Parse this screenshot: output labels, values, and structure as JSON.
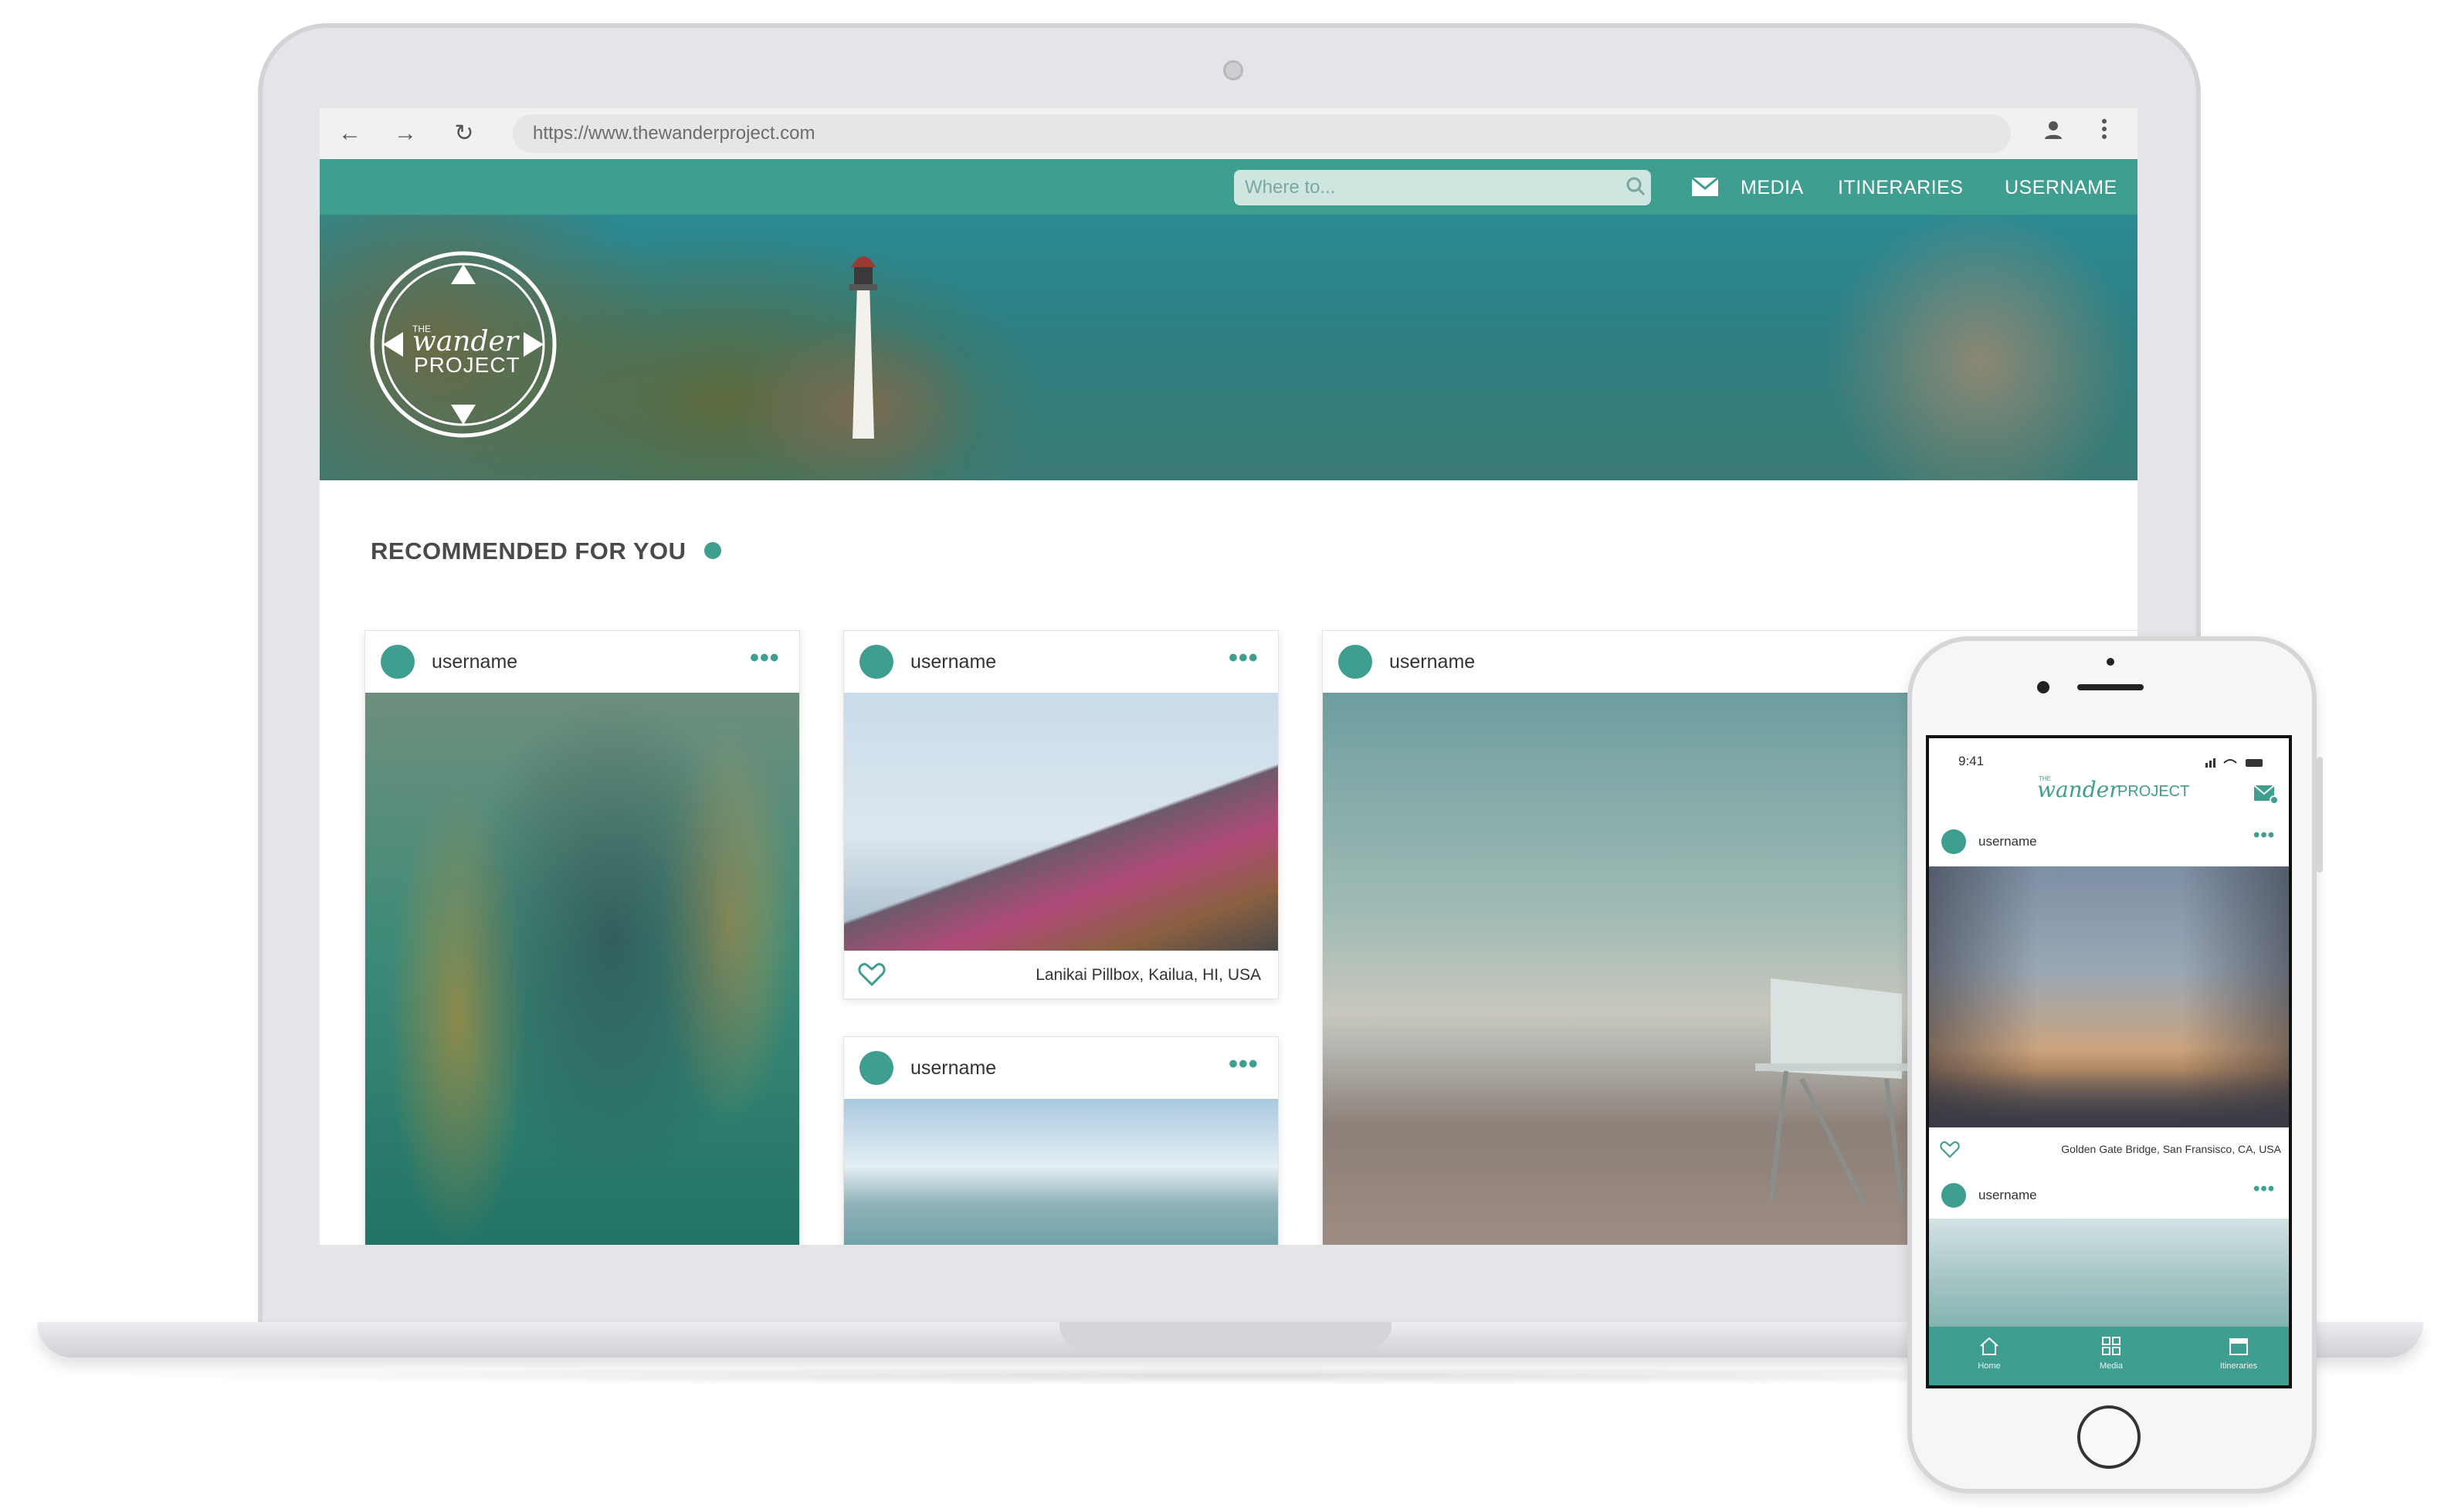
{
  "browser": {
    "url": "https://www.thewanderproject.com"
  },
  "header": {
    "search_placeholder": "Where to...",
    "nav": [
      "MEDIA",
      "ITINERARIES",
      "USERNAME"
    ],
    "logo": {
      "the": "THE",
      "wander": "wander",
      "project": "PROJECT"
    }
  },
  "main": {
    "section_title": "RECOMMENDED FOR YOU",
    "cards": [
      {
        "username": "username",
        "image": "school of fish in kelp forest"
      },
      {
        "username": "username",
        "image": "people sitting on graffiti pillbox",
        "caption": "Lanikai Pillbox, Kailua, HI, USA"
      },
      {
        "username": "username",
        "image": "lifeguard tower on beach at sunset"
      },
      {
        "username": "username",
        "image": "ocean and islands"
      }
    ]
  },
  "phone": {
    "time": "9:41",
    "logo": {
      "the": "THE",
      "wander": "wander",
      "project": "PROJECT"
    },
    "posts": [
      {
        "username": "username",
        "caption": "Golden Gate Bridge, San Fransisco, CA, USA"
      },
      {
        "username": "username"
      }
    ],
    "tabs": [
      {
        "label": "Home",
        "icon": "home-icon"
      },
      {
        "label": "Media",
        "icon": "grid-icon"
      },
      {
        "label": "Itineraries",
        "icon": "calendar-icon"
      }
    ]
  },
  "colors": {
    "accent": "#3e9e90"
  }
}
